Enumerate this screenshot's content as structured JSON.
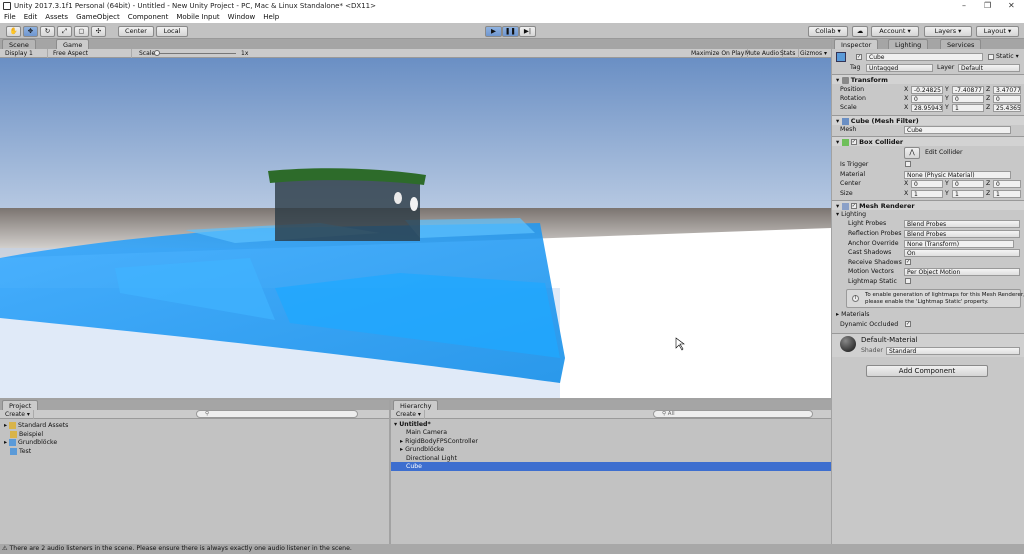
{
  "window": {
    "title": "Unity 2017.3.1f1 Personal (64bit) - Untitled - New Unity Project - PC, Mac & Linux Standalone* <DX11>",
    "controls": [
      "–",
      "❐",
      "✕"
    ]
  },
  "menu": [
    "File",
    "Edit",
    "Assets",
    "GameObject",
    "Component",
    "Mobile Input",
    "Window",
    "Help"
  ],
  "toolbar": {
    "pivot": "Center",
    "space": "Local",
    "collab": "Collab ▾",
    "account": "Account ▾",
    "layers": "Layers ▾",
    "layout": "Layout ▾"
  },
  "scene_tabs": {
    "scene": "Scene",
    "game": "Game"
  },
  "game_bar": {
    "display": "Display 1",
    "aspect": "Free Aspect",
    "scale_label": "Scale",
    "scale_value": "1x",
    "maximize": "Maximize On Play",
    "mute": "Mute Audio",
    "stats": "Stats",
    "gizmos": "Gizmos ▾"
  },
  "inspector": {
    "tabs": [
      "Inspector",
      "Lighting",
      "Services"
    ],
    "object_name": "Cube",
    "static": "Static ▾",
    "tag_label": "Tag",
    "tag": "Untagged",
    "layer_label": "Layer",
    "layer": "Default",
    "transform": {
      "title": "Transform",
      "position": {
        "label": "Position",
        "x": "-0.24825",
        "y": "-7.40877",
        "z": "3.470776"
      },
      "rotation": {
        "label": "Rotation",
        "x": "0",
        "y": "0",
        "z": "0"
      },
      "scale": {
        "label": "Scale",
        "x": "28.95943",
        "y": "1",
        "z": "25.4365"
      }
    },
    "mesh_filter": {
      "title": "Cube (Mesh Filter)",
      "mesh_label": "Mesh",
      "mesh": "Cube"
    },
    "box_collider": {
      "title": "Box Collider",
      "edit": "Edit Collider",
      "is_trigger": "Is Trigger",
      "material_label": "Material",
      "material": "None (Physic Material)",
      "center": {
        "label": "Center",
        "x": "0",
        "y": "0",
        "z": "0"
      },
      "size": {
        "label": "Size",
        "x": "1",
        "y": "1",
        "z": "1"
      }
    },
    "mesh_renderer": {
      "title": "Mesh Renderer",
      "lighting": "Lighting",
      "light_probes_label": "Light Probes",
      "light_probes": "Blend Probes",
      "reflection_probes_label": "Reflection Probes",
      "reflection_probes": "Blend Probes",
      "anchor_label": "Anchor Override",
      "anchor": "None (Transform)",
      "cast_label": "Cast Shadows",
      "cast": "On",
      "receive_label": "Receive Shadows",
      "motion_label": "Motion Vectors",
      "motion": "Per Object Motion",
      "lightmap_label": "Lightmap Static",
      "info_line1": "To enable generation of lightmaps for this Mesh Renderer,",
      "info_line2": "please enable the 'Lightmap Static' property.",
      "materials": "Materials",
      "dynamic_occluded": "Dynamic Occluded"
    },
    "material": {
      "name": "Default-Material",
      "shader_label": "Shader",
      "shader": "Standard"
    },
    "add_component": "Add Component"
  },
  "project": {
    "tab": "Project",
    "create": "Create ▾",
    "items": [
      "Standard Assets",
      "Beispiel",
      "Grundblöcke",
      "Test"
    ]
  },
  "hierarchy": {
    "tab": "Hierarchy",
    "create": "Create ▾",
    "search": "All",
    "scene": "Untitled*",
    "items": [
      "Main Camera",
      "RigidBodyFPSController",
      "Grundblöcke",
      "Directional Light",
      "Cube"
    ]
  },
  "status": "There are 2 audio listeners in the scene. Please ensure there is always exactly one audio listener in the scene.",
  "colors": {
    "selection": "#3d6ecf",
    "water": "#1a9bf0"
  }
}
